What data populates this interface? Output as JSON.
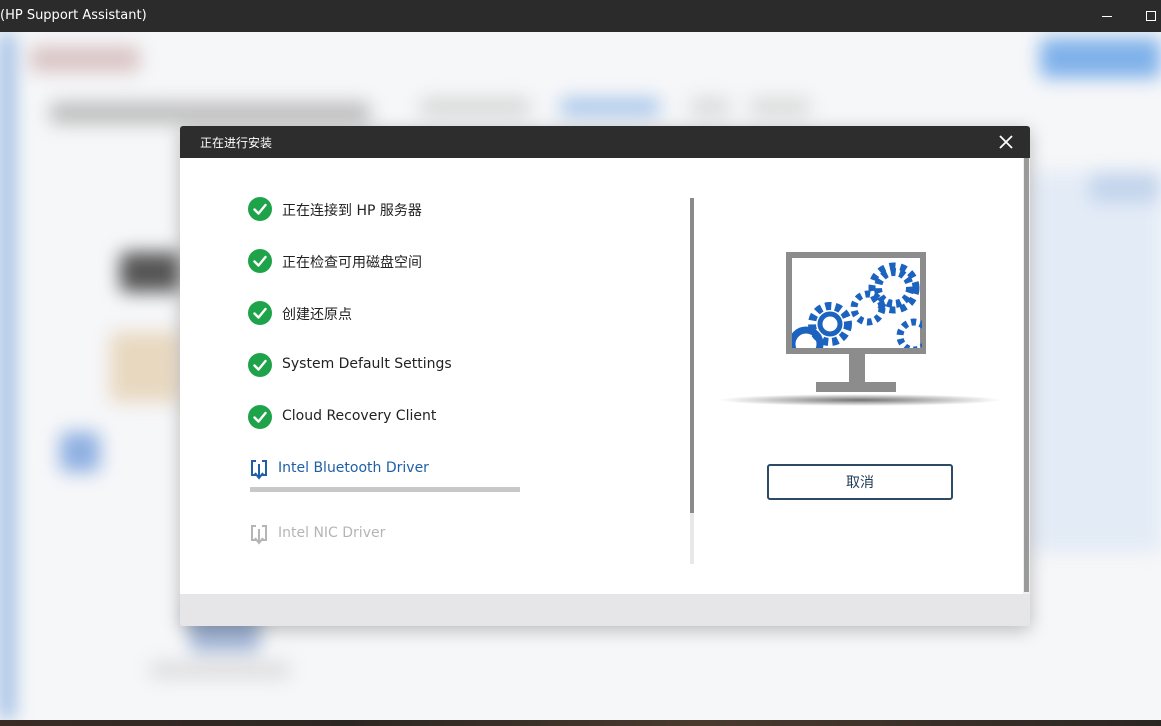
{
  "window": {
    "title": "(HP Support Assistant)"
  },
  "dialog": {
    "title": "正在进行安装",
    "cancel_label": "取消",
    "steps": [
      {
        "label": "正在连接到 HP 服务器",
        "status": "done"
      },
      {
        "label": "正在检查可用磁盘空间",
        "status": "done"
      },
      {
        "label": "创建还原点",
        "status": "done"
      },
      {
        "label": "System Default Settings",
        "status": "done"
      },
      {
        "label": "Cloud Recovery Client",
        "status": "done"
      },
      {
        "label": "Intel Bluetooth Driver",
        "status": "in-progress",
        "progress_percent": 100
      },
      {
        "label": "Intel NIC Driver",
        "status": "pending"
      }
    ]
  },
  "colors": {
    "success_green": "#1fa34a",
    "active_blue": "#1f5fa8",
    "pending_gray": "#b5b5b5",
    "gear_blue": "#1c62bf"
  },
  "icons": {
    "done": "check-circle-icon",
    "in-progress": "download-icon",
    "pending": "download-icon",
    "close": "close-icon",
    "illustration": "monitor-gears-icon"
  }
}
